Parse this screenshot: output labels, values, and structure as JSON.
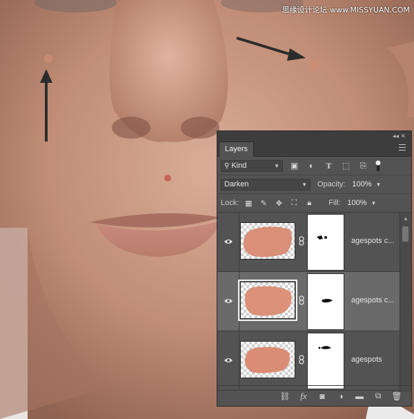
{
  "watermark": "思缘设计论坛 www.MISSYUAN.COM",
  "panel": {
    "tab_label": "Layers",
    "filter": {
      "kind_label": "Kind"
    },
    "blend_mode": "Darken",
    "opacity_label": "Opacity:",
    "opacity_value": "100%",
    "lock_label": "Lock:",
    "fill_label": "Fill:",
    "fill_value": "100%",
    "layers": [
      {
        "name": "agespots c...",
        "selected": false
      },
      {
        "name": "agespots c...",
        "selected": true
      },
      {
        "name": "agespots",
        "selected": false
      }
    ],
    "footer_icons": [
      "link-icon",
      "fx-icon",
      "mask-icon",
      "adjustment-icon",
      "group-folder-icon",
      "new-layer-icon",
      "trash-icon"
    ],
    "filter_icons": [
      "image-filter-icon",
      "adjustment-filter-icon",
      "type-filter-icon",
      "shape-filter-icon",
      "smart-object-filter-icon"
    ],
    "lock_icons": [
      "lock-pixels-icon",
      "lock-image-icon",
      "lock-position-icon",
      "lock-artboard-icon",
      "lock-all-icon"
    ]
  },
  "colors": {
    "panel_bg": "#535353",
    "selected_row": "#6a6a6a",
    "skin": "#c99680"
  }
}
